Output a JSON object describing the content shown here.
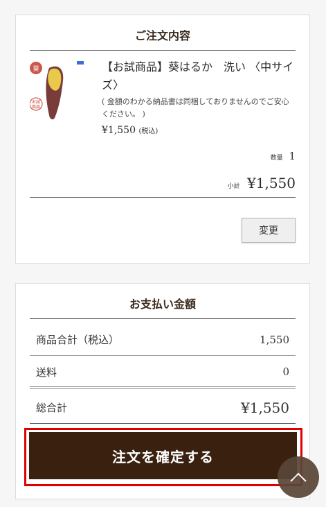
{
  "order": {
    "title": "ご注文内容",
    "product": {
      "name": "【お試商品】葵はるか　洗い 〈中サイズ〉",
      "note": "( 金額のわかる納品書は同梱しておりませんのでご安心ください。 )",
      "price": "¥1,550",
      "tax_note": "(税込)",
      "image": "sweet-potato-thumbnail"
    },
    "quantity_label": "数量",
    "quantity": "1",
    "subtotal_label": "小計",
    "subtotal": "¥1,550",
    "change_label": "変更"
  },
  "payment": {
    "title": "お支払い金額",
    "rows": [
      {
        "label": "商品合計（税込）",
        "value": "1,550"
      },
      {
        "label": "送料",
        "value": "0"
      }
    ],
    "total_label": "総合計",
    "total": "¥1,550"
  },
  "confirm_label": "注文を確定する",
  "icons": {
    "scroll_top": "chevron-up-icon"
  },
  "colors": {
    "confirm_bg": "#3a210f",
    "highlight": "#e00000",
    "to_top_bg": "#5a4637"
  }
}
